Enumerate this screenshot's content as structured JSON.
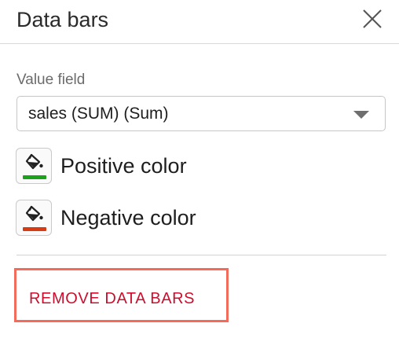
{
  "panel": {
    "title": "Data bars"
  },
  "value_field": {
    "label": "Value field",
    "selected": "sales (SUM) (Sum)"
  },
  "positive": {
    "label": "Positive color",
    "color": "#1aa31a"
  },
  "negative": {
    "label": "Negative color",
    "color": "#d83a14"
  },
  "actions": {
    "remove_label": "REMOVE DATA BARS"
  },
  "icons": {
    "close": "close-icon",
    "bucket": "paint-bucket-icon",
    "dropdown": "chevron-down-icon"
  },
  "colors": {
    "highlight_border": "#f26b5b",
    "remove_text": "#c8102e"
  }
}
